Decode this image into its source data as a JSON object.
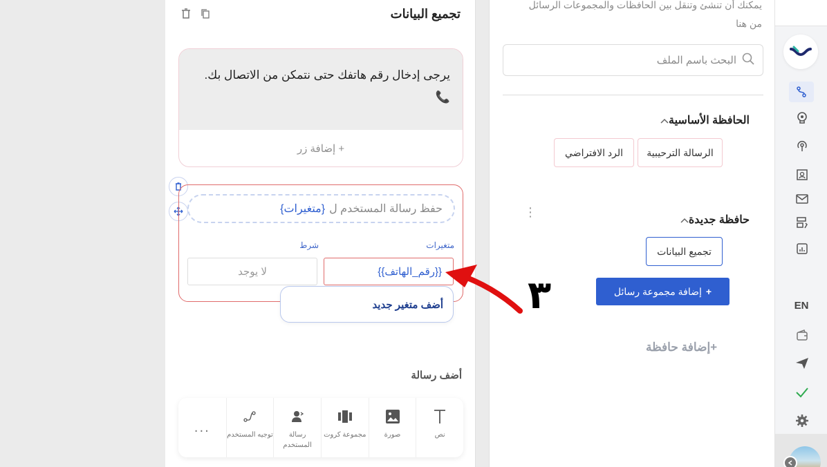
{
  "rail": {
    "language": "EN",
    "icons": [
      "flow-icon",
      "brain-icon",
      "broadcast-icon",
      "contacts-icon",
      "mail-icon",
      "templates-icon",
      "analytics-icon",
      "wallet-icon",
      "send-icon",
      "check-icon",
      "gear-icon"
    ]
  },
  "folders_panel": {
    "hint": "يمكنك أن تنشئ وتنقل بين الحافظات والمجموعات الرسائل من هنا",
    "search_placeholder": "البحث باسم الملف",
    "main_folder": {
      "title": "الحافظة الأساسية",
      "items": [
        "الرسالة الترحيبية",
        "الرد الافتراضي"
      ]
    },
    "new_folder": {
      "title": "حافظة جديدة",
      "items": [
        "تجميع البيانات"
      ]
    },
    "add_group_label": "إضافة مجموعة رسائل",
    "add_group_plus": "+",
    "add_folder_label": "+إضافة حافظة"
  },
  "editor": {
    "title": "تجميع البيانات",
    "message_text": "يرجى إدخال رقم هاتفك حتى نتمكن من الاتصال بك.",
    "message_emoji": "📞",
    "add_button_label": "+ إضافة زر",
    "save_prefix": "حفظ رسالة المستخدم ل",
    "save_variable": "{متغيرات}",
    "variables_label": "متغيرات",
    "condition_label": "شرط",
    "variable_value": "{{رقم_الهاتف}}",
    "condition_value": "لا يوجد",
    "add_variable_label": "أضف متغير جديد",
    "add_message_title": "أضف رسالة",
    "tools": [
      {
        "label": "نص"
      },
      {
        "label": "صورة"
      },
      {
        "label": "مجموعة كروت"
      },
      {
        "label": "رسالة المستخدم"
      },
      {
        "label": "توجيه المستخدم"
      }
    ],
    "more_label": "..."
  },
  "annotation": {
    "number": "٣",
    "color": "#e01010"
  },
  "colors": {
    "accent": "#2f5fd0",
    "error_border": "#e06b6b"
  }
}
